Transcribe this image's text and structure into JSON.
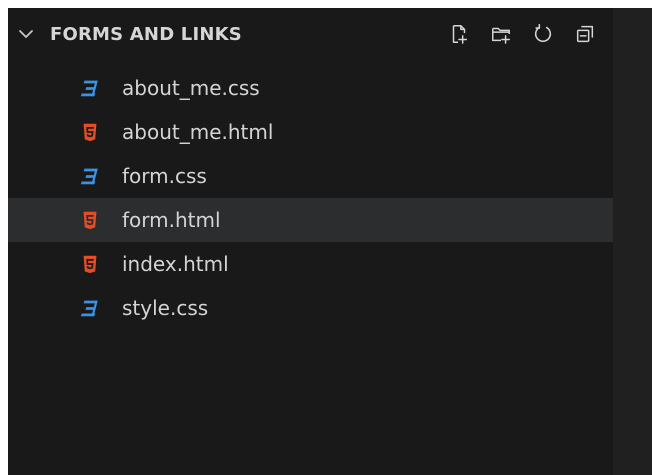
{
  "explorer": {
    "title": "FORMS AND LINKS",
    "actions": [
      {
        "name": "new-file-icon"
      },
      {
        "name": "new-folder-icon"
      },
      {
        "name": "refresh-icon"
      },
      {
        "name": "collapse-all-icon"
      }
    ],
    "files": [
      {
        "name": "about_me.css",
        "icon": "css-icon",
        "selected": false
      },
      {
        "name": "about_me.html",
        "icon": "html-icon",
        "selected": false
      },
      {
        "name": "form.css",
        "icon": "css-icon",
        "selected": false
      },
      {
        "name": "form.html",
        "icon": "html-icon",
        "selected": true
      },
      {
        "name": "index.html",
        "icon": "html-icon",
        "selected": false
      },
      {
        "name": "style.css",
        "icon": "css-icon",
        "selected": false
      }
    ]
  },
  "colors": {
    "panel_bg": "#191919",
    "selected_row": "#2b2d2e",
    "text": "#d4d4d4",
    "css_icon": "#3b91e6",
    "html_icon": "#e44d26",
    "toolbar_icon": "#d6d6d6"
  }
}
